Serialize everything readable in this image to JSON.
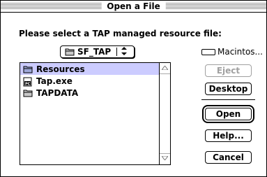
{
  "dialog": {
    "title": "Open a File",
    "prompt": "Please select a TAP managed resource file:"
  },
  "folder_popup": {
    "label": "SF_TAP",
    "icon": "folder-icon",
    "arrow": "up-down-arrows-icon"
  },
  "drive": {
    "label": "Macintos...",
    "icon": "drive-icon"
  },
  "files": [
    {
      "name": "Resources",
      "icon": "folder-icon",
      "selected": true
    },
    {
      "name": "Tap.exe",
      "icon": "pc-document-icon",
      "selected": false
    },
    {
      "name": "TAPDATA",
      "icon": "folder-icon",
      "selected": false
    }
  ],
  "buttons": {
    "eject": "Eject",
    "desktop": "Desktop",
    "open": "Open",
    "help": "Help...",
    "cancel": "Cancel"
  },
  "colors": {
    "selection": "#ccccff",
    "disabled": "#a0a0a0"
  }
}
